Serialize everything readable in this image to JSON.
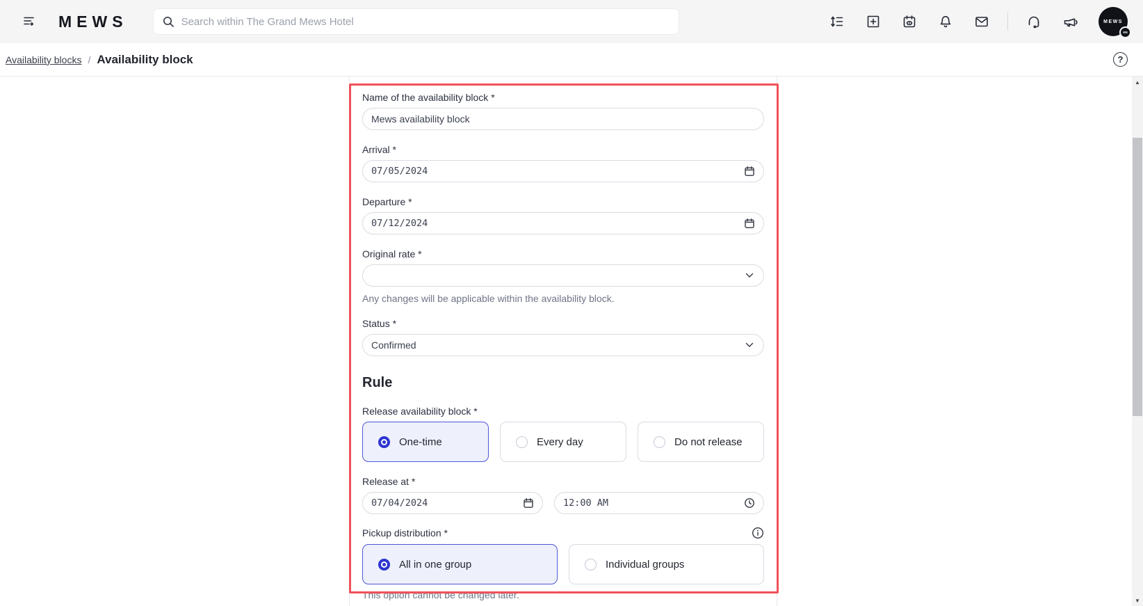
{
  "header": {
    "logo": "MEWS",
    "search_placeholder": "Search within The Grand Mews Hotel",
    "action_icons": [
      "line-spacing",
      "create-new",
      "calendar-view",
      "notifications",
      "messages",
      "support",
      "announcements"
    ],
    "avatar_text": "MEWS"
  },
  "breadcrumb": {
    "parent": "Availability blocks",
    "separator": "/",
    "current": "Availability block"
  },
  "form": {
    "name": {
      "label": "Name of the availability block *",
      "value": "Mews availability block"
    },
    "arrival": {
      "label": "Arrival *",
      "value": "07/05/2024"
    },
    "departure": {
      "label": "Departure *",
      "value": "07/12/2024"
    },
    "original_rate": {
      "label": "Original rate *",
      "value": "",
      "helper": "Any changes will be applicable within the availability block."
    },
    "status": {
      "label": "Status *",
      "value": "Confirmed"
    },
    "rule": {
      "title": "Rule",
      "release": {
        "label": "Release availability block *",
        "options": [
          {
            "label": "One-time",
            "selected": true
          },
          {
            "label": "Every day",
            "selected": false
          },
          {
            "label": "Do not release",
            "selected": false
          }
        ]
      },
      "release_at": {
        "label": "Release at *",
        "date": "07/04/2024",
        "time": "12:00 AM"
      },
      "pickup": {
        "label": "Pickup distribution *",
        "options": [
          {
            "label": "All in one group",
            "selected": true
          },
          {
            "label": "Individual groups",
            "selected": false
          }
        ],
        "helper": "This option cannot be changed later."
      }
    }
  },
  "colors": {
    "accent": "#2e35d1",
    "selected_border": "#5056d6",
    "selected_bg": "#eef0fc",
    "annotation": "#f0515a"
  }
}
